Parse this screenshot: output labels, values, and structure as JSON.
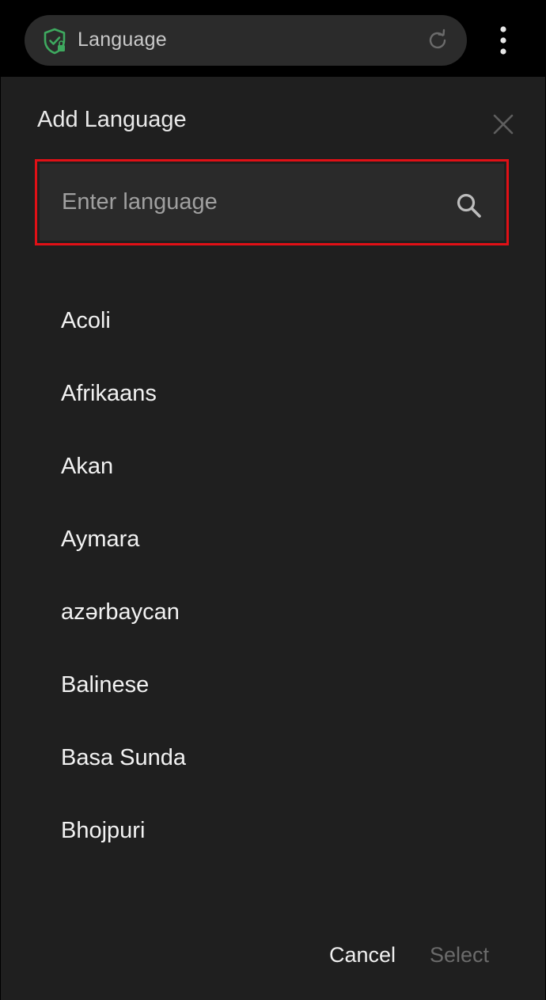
{
  "browser": {
    "url_text": "Language",
    "icons": {
      "security": "shield-lock-icon",
      "reload": "reload-icon",
      "menu": "more-vert-icon"
    }
  },
  "dialog": {
    "title": "Add Language",
    "search": {
      "placeholder": "Enter language",
      "value": ""
    },
    "languages": [
      "Acoli",
      "Afrikaans",
      "Akan",
      "Aymara",
      "azərbaycan",
      "Balinese",
      "Basa Sunda",
      "Bhojpuri"
    ],
    "actions": {
      "cancel": "Cancel",
      "select": "Select"
    }
  },
  "colors": {
    "highlight": "#e01016",
    "shield": "#3ea95f",
    "dialog_bg": "#1f1f1f"
  }
}
